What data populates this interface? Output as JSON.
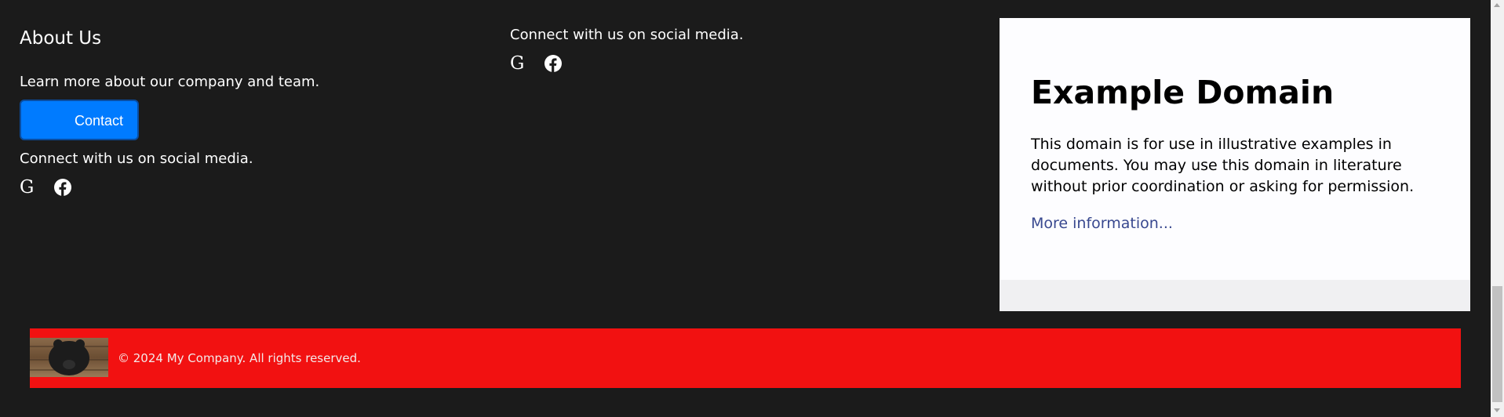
{
  "about": {
    "title": "About Us",
    "description": "Learn more about our company and team.",
    "contact_label": "Contact",
    "social_text": "Connect with us on social media.",
    "social_icons": [
      "google-icon",
      "facebook-icon"
    ],
    "google_glyph": "G"
  },
  "social_column": {
    "social_text": "Connect with us on social media.",
    "social_icons": [
      "google-icon",
      "facebook-icon"
    ],
    "google_glyph": "G"
  },
  "example_domain": {
    "title": "Example Domain",
    "text": "This domain is for use in illustrative examples in documents. You may use this domain in literature without prior coordination or asking for permission.",
    "link": "More information..."
  },
  "footer": {
    "copyright": "© 2024 My Company. All rights reserved.",
    "logo_icon": "bear-photo-logo"
  },
  "colors": {
    "page_background": "#1b1b1b",
    "contact_button": "#007bff",
    "footer_background": "#f21111",
    "link": "#38488f"
  }
}
